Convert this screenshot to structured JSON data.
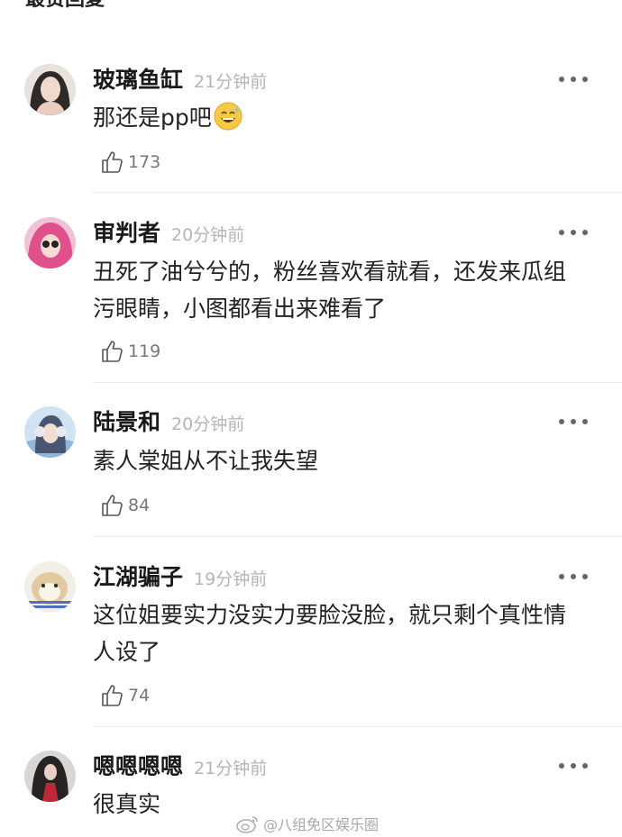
{
  "section": {
    "title": "最赞回复"
  },
  "comments": [
    {
      "name": "玻璃鱼缸",
      "time": "21分钟前",
      "text": "那还是pp吧",
      "emoji": "sweat-smile-emoji",
      "likes": "173",
      "avatar_color": "#3a3534"
    },
    {
      "name": "审判者",
      "time": "20分钟前",
      "text": "丑死了油兮兮的，粉丝喜欢看就看，还发来瓜组污眼睛，小图都看出来难看了",
      "likes": "119",
      "avatar_color": "#d8548c"
    },
    {
      "name": "陆景和",
      "time": "20分钟前",
      "text": "素人棠姐从不让我失望",
      "likes": "84",
      "avatar_color": "#6f85a8"
    },
    {
      "name": "江湖骗子",
      "time": "19分钟前",
      "text": "这位姐要实力没实力要脸没脸，就只剩个真性情人设了",
      "likes": "74",
      "avatar_color": "#d9c4a2"
    },
    {
      "name": "嗯嗯嗯嗯",
      "time": "21分钟前",
      "text": "很真实",
      "avatar_color": "#2f2b2c"
    }
  ],
  "watermark": {
    "text": "@八组免区娱乐圈",
    "icon": "weibo-logo-icon"
  }
}
